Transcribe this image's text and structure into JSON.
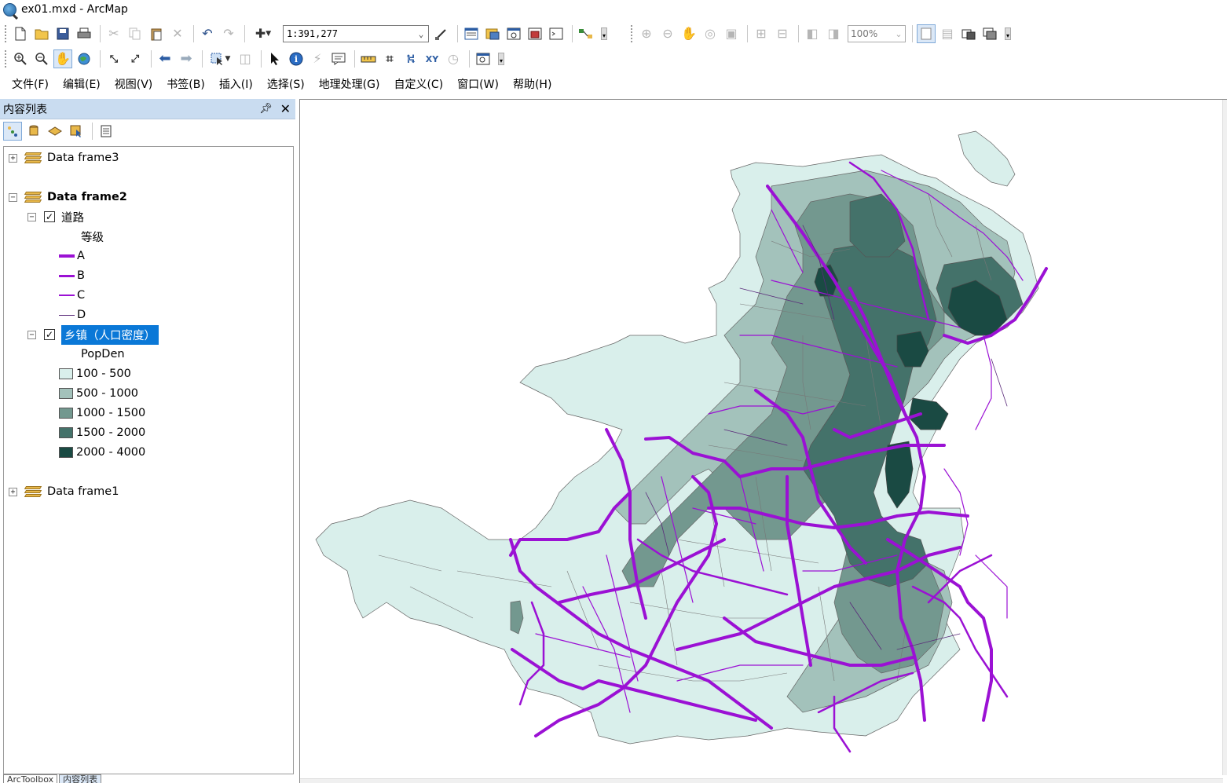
{
  "window": {
    "title": "ex01.mxd - ArcMap"
  },
  "toolbar1": {
    "scale_value": "1:391,277",
    "zoom_value": "100%",
    "icons": [
      "new-document-icon",
      "open-folder-icon",
      "save-icon",
      "print-icon",
      "cut-icon",
      "copy-icon",
      "paste-icon",
      "delete-icon",
      "undo-icon",
      "redo-icon",
      "add-data-icon",
      "editor-icon",
      "table-of-contents-icon",
      "catalog-icon",
      "search-window-icon",
      "arctoolbox-icon",
      "python-icon",
      "model-builder-icon"
    ]
  },
  "menu": {
    "file": "文件(F)",
    "edit": "编辑(E)",
    "view": "视图(V)",
    "bookmarks": "书签(B)",
    "insert": "插入(I)",
    "selection": "选择(S)",
    "geoprocessing": "地理处理(G)",
    "customize": "自定义(C)",
    "windows": "窗口(W)",
    "help": "帮助(H)"
  },
  "toc": {
    "title": "内容列表",
    "data_frames": [
      {
        "name": "Data frame3",
        "expanded": false,
        "active": false
      },
      {
        "name": "Data frame2",
        "expanded": true,
        "active": true
      },
      {
        "name": "Data frame1",
        "expanded": false,
        "active": false
      }
    ],
    "roads_layer": {
      "name": "道路",
      "checked": true,
      "field": "等级",
      "classes": [
        {
          "label": "A",
          "weight": "heaviest"
        },
        {
          "label": "B",
          "weight": "heavy"
        },
        {
          "label": "C",
          "weight": "thin"
        },
        {
          "label": "D",
          "weight": "thinnest"
        }
      ],
      "color": "#9b11d4"
    },
    "towns_layer": {
      "name": "乡镇（人口密度）",
      "checked": true,
      "selected": true,
      "field": "PopDen",
      "classes": [
        {
          "label": "100 - 500",
          "color": "#d9efeb"
        },
        {
          "label": "500 - 1000",
          "color": "#a3c2bb"
        },
        {
          "label": "1000 - 1500",
          "color": "#73988f"
        },
        {
          "label": "1500 - 2000",
          "color": "#44726a"
        },
        {
          "label": "2000 - 4000",
          "color": "#1a4a43"
        }
      ]
    }
  },
  "bottom_tabs": {
    "arctoolbox": "ArcToolbox",
    "toc": "内容列表"
  }
}
